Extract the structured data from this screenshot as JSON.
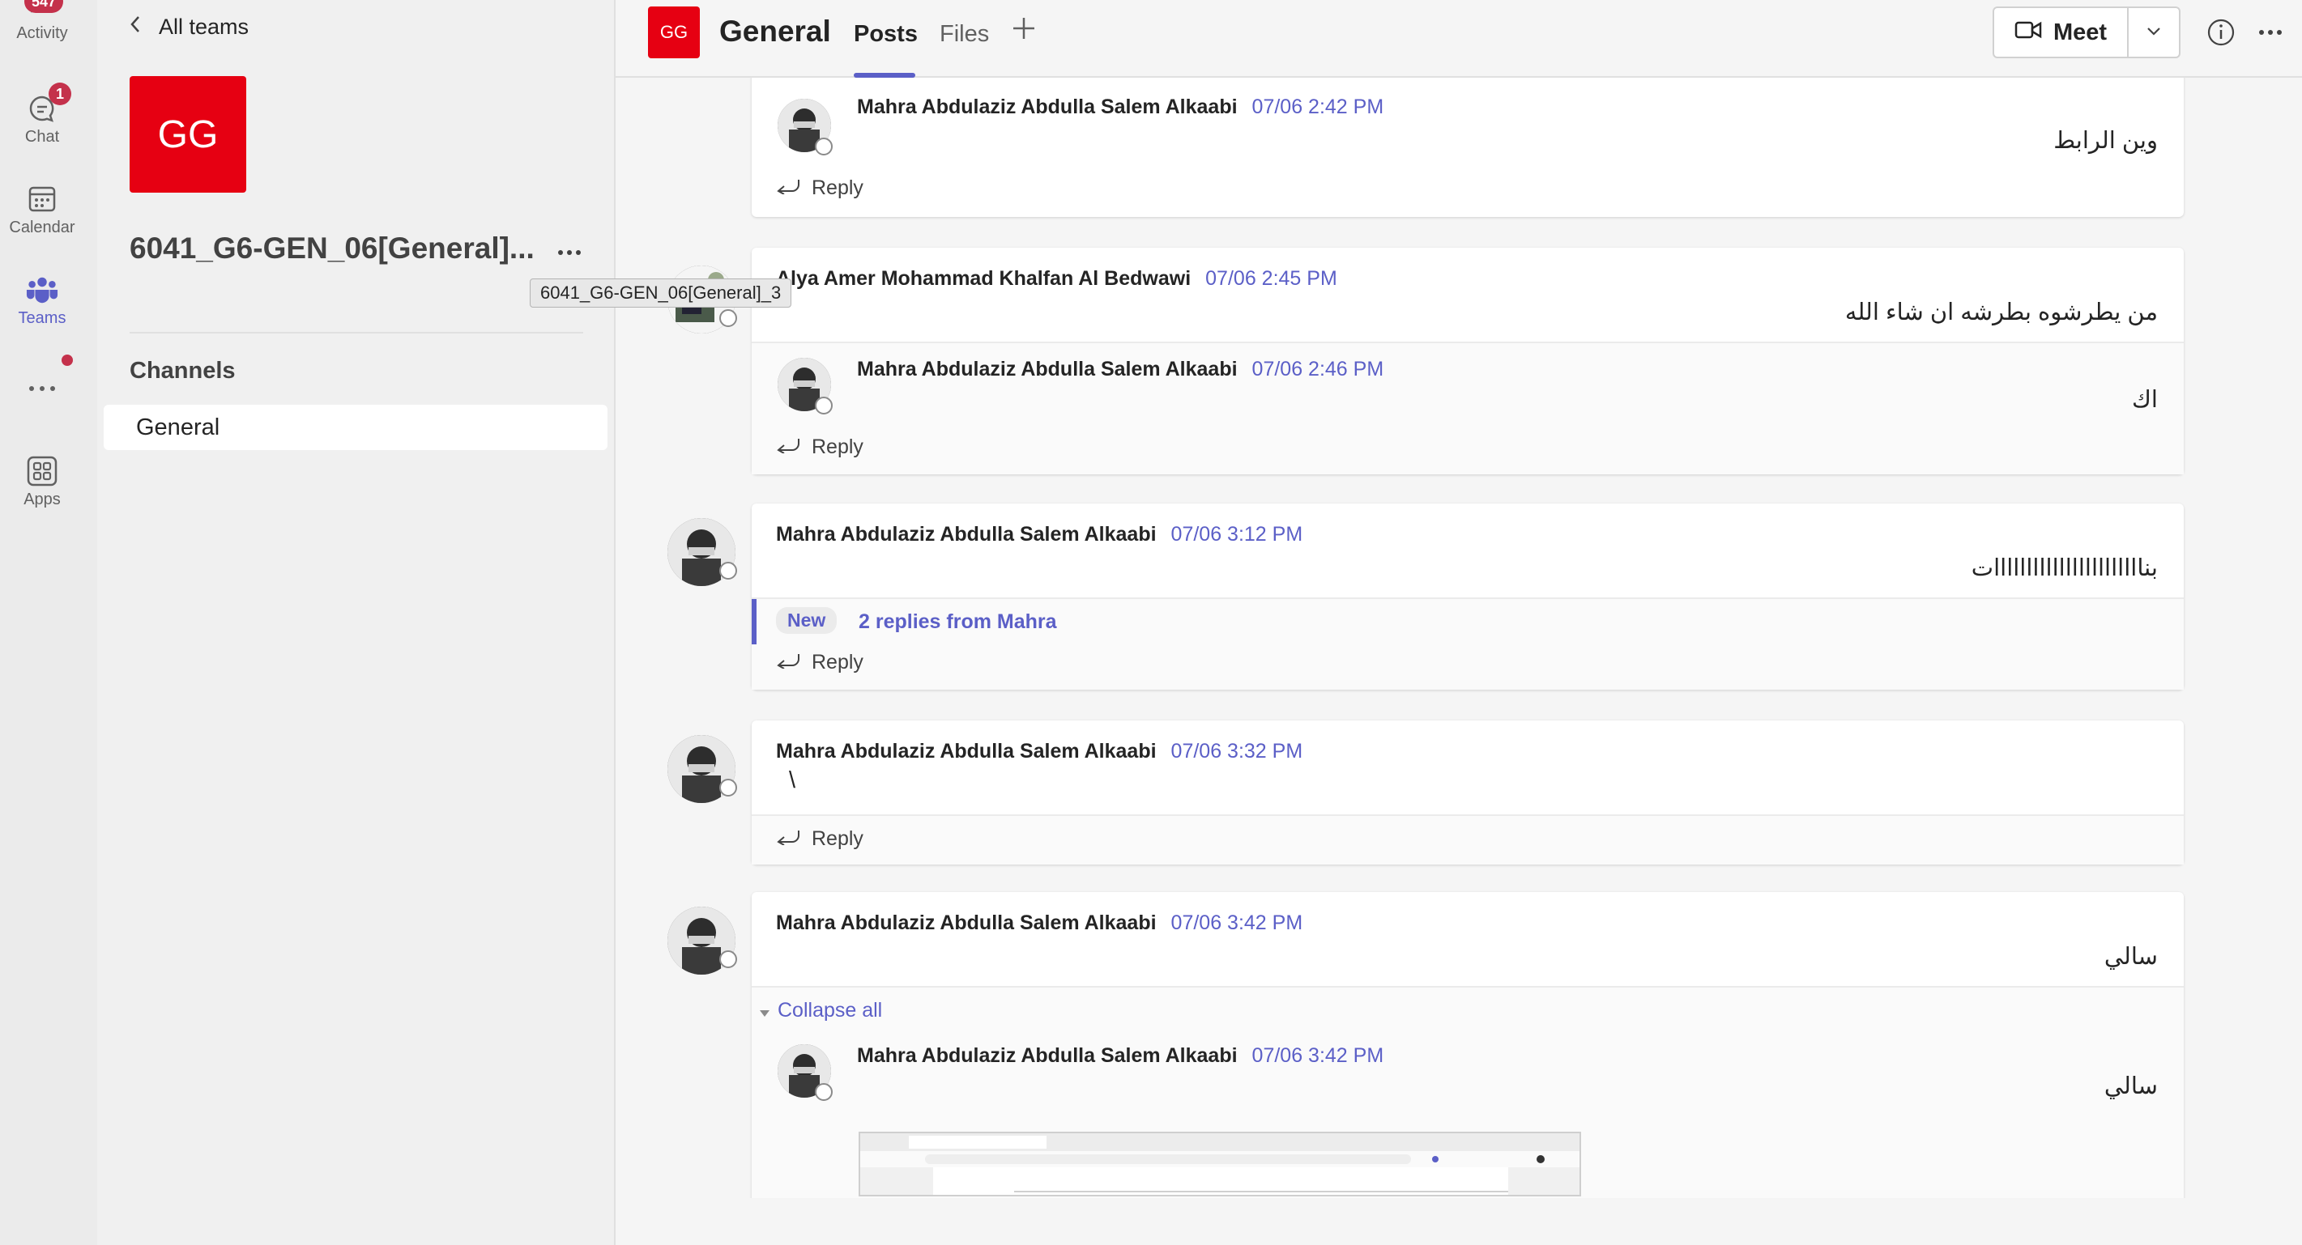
{
  "rail": {
    "activity": {
      "label": "Activity",
      "badge": "547"
    },
    "chat": {
      "label": "Chat",
      "badge": "1"
    },
    "calendar": {
      "label": "Calendar"
    },
    "teams": {
      "label": "Teams"
    },
    "more": {
      "label": "..."
    },
    "apps": {
      "label": "Apps"
    }
  },
  "team_panel": {
    "back_label": "All teams",
    "avatar_initials": "GG",
    "team_name": "6041_G6-GEN_06[General]...",
    "tooltip": "6041_G6-GEN_06[General]_3",
    "channels_heading": "Channels",
    "channels": [
      "General"
    ]
  },
  "header": {
    "avatar_initials": "GG",
    "title": "General",
    "tabs": [
      "Posts",
      "Files"
    ],
    "meet_label": "Meet"
  },
  "feed": {
    "reply_label": "Reply",
    "messages": [
      {
        "author": "Mahra Abdulaziz Abdulla Salem Alkaabi",
        "time": "07/06 2:42 PM",
        "body": "وين الرابط"
      },
      {
        "author": "Alya Amer Mohammad Khalfan Al Bedwawi",
        "time": "07/06 2:45 PM",
        "body": "من يطرشوه بطرشه ان شاء الله"
      },
      {
        "author": "Mahra Abdulaziz Abdulla Salem Alkaabi",
        "time": "07/06 2:46 PM",
        "body": "اك"
      },
      {
        "author": "Mahra Abdulaziz Abdulla Salem Alkaabi",
        "time": "07/06 3:12 PM",
        "body": "بنااااااااااااااااااااااات"
      },
      {
        "author": "Mahra Abdulaziz Abdulla Salem Alkaabi",
        "time": "07/06 3:32 PM",
        "body": "\\"
      },
      {
        "author": "Mahra Abdulaziz Abdulla Salem Alkaabi",
        "time": "07/06 3:42 PM",
        "body": "سالي"
      },
      {
        "author": "Mahra Abdulaziz Abdulla Salem Alkaabi",
        "time": "07/06 3:42 PM",
        "body": "سالي"
      }
    ],
    "new_pill": "New",
    "replies_link": "2 replies from Mahra",
    "collapse_all": "Collapse all"
  },
  "colors": {
    "accent": "#5b5fc7",
    "team_red": "#e60012",
    "badge_red": "#c4314b"
  }
}
